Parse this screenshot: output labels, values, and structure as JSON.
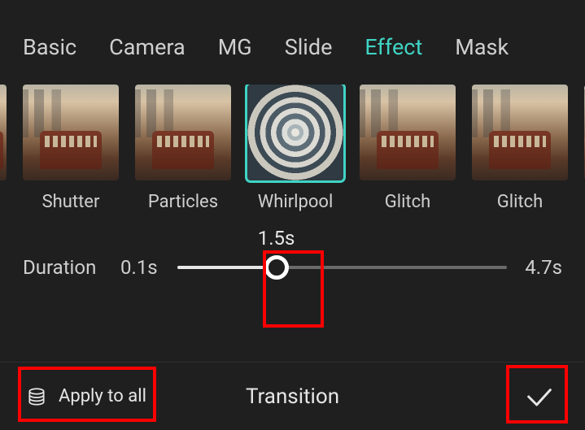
{
  "tabs": [
    {
      "label": "Basic",
      "active": false
    },
    {
      "label": "Camera",
      "active": false
    },
    {
      "label": "MG",
      "active": false
    },
    {
      "label": "Slide",
      "active": false
    },
    {
      "label": "Effect",
      "active": true
    },
    {
      "label": "Mask",
      "active": false
    }
  ],
  "effects": [
    {
      "label": "Shutter",
      "selected": false
    },
    {
      "label": "Particles",
      "selected": false
    },
    {
      "label": "Whirlpool",
      "selected": true
    },
    {
      "label": "Glitch",
      "selected": false
    },
    {
      "label": "Glitch",
      "selected": false
    }
  ],
  "duration": {
    "label": "Duration",
    "min": "0.1s",
    "max": "4.7s",
    "value": "1.5s",
    "fraction": 0.3
  },
  "bottom": {
    "apply_all": "Apply to all",
    "title": "Transition"
  },
  "colors": {
    "accent": "#3fd4c4",
    "highlight": "#ff0000"
  }
}
